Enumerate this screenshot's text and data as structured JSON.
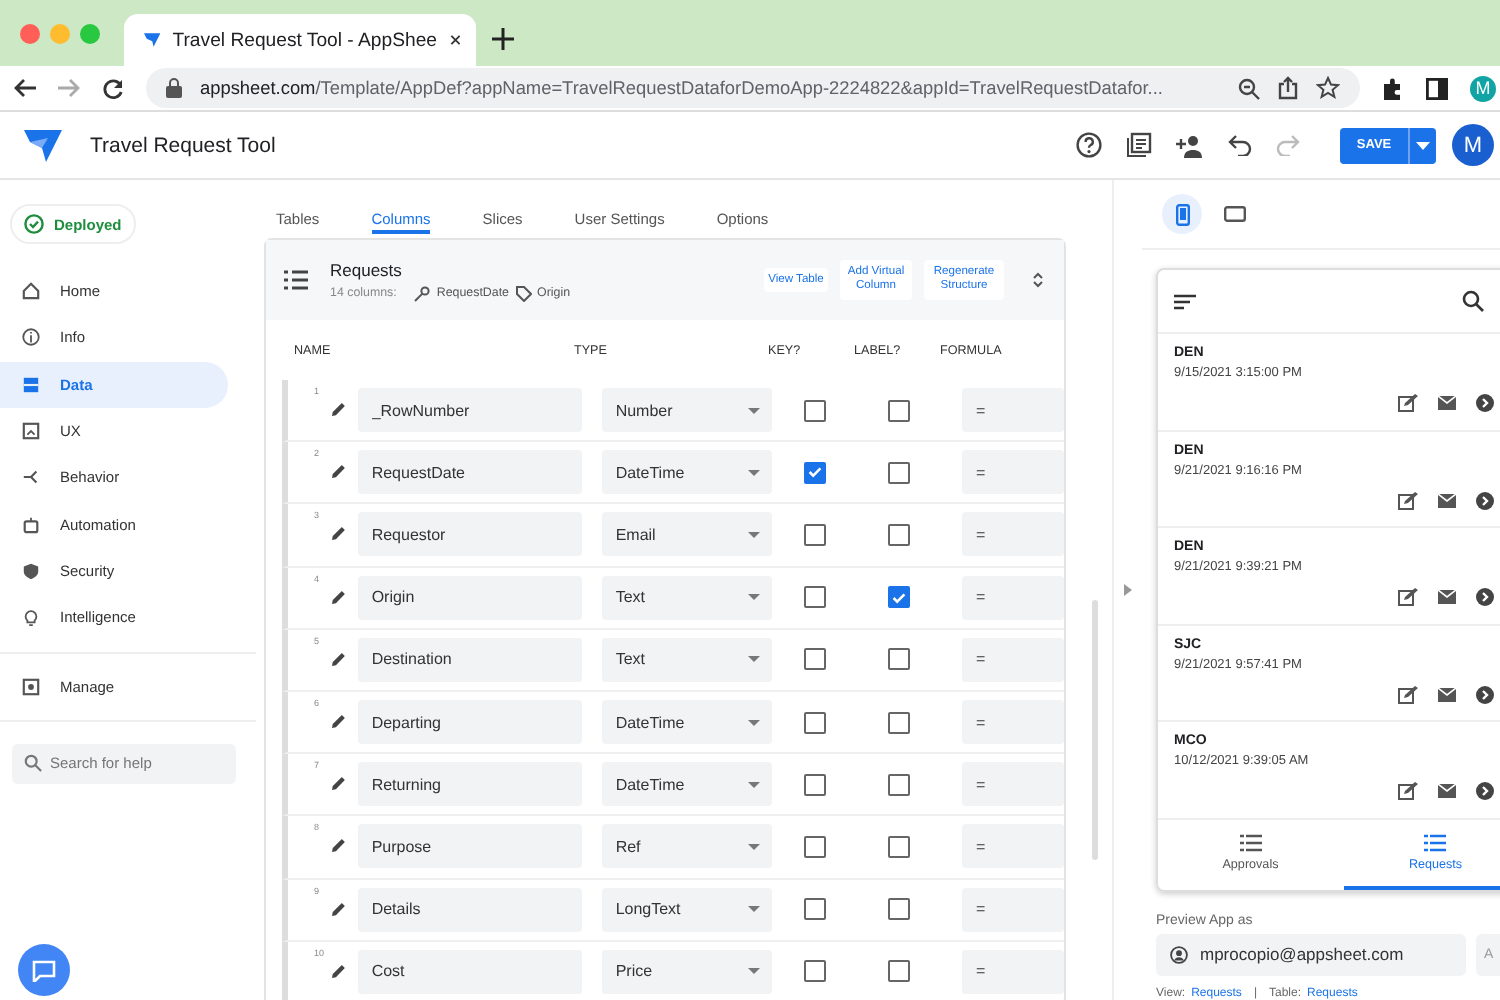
{
  "browser": {
    "tab_title": "Travel Request Tool - AppShee",
    "url_host": "appsheet.com",
    "url_path": "/Template/AppDef?appName=TravelRequestDataforDemoApp-2224822&appId=TravelRequestDatafor...",
    "profile_initial": "M"
  },
  "app": {
    "title": "Travel Request Tool",
    "save": "SAVE",
    "avatar_initial": "M"
  },
  "sidebar": {
    "status": "Deployed",
    "items": [
      {
        "label": "Home",
        "selected": false
      },
      {
        "label": "Info",
        "selected": false
      },
      {
        "label": "Data",
        "selected": true
      },
      {
        "label": "UX",
        "selected": false
      },
      {
        "label": "Behavior",
        "selected": false
      },
      {
        "label": "Automation",
        "selected": false
      },
      {
        "label": "Security",
        "selected": false
      },
      {
        "label": "Intelligence",
        "selected": false
      }
    ],
    "manage": "Manage",
    "search": {
      "placeholder": "Search for help"
    }
  },
  "tabs": [
    {
      "label": "Tables",
      "selected": false
    },
    {
      "label": "Columns",
      "selected": true
    },
    {
      "label": "Slices",
      "selected": false
    },
    {
      "label": "User Settings",
      "selected": false
    },
    {
      "label": "Options",
      "selected": false
    }
  ],
  "table": {
    "name": "Requests",
    "column_count": "14 columns:",
    "key_column": "RequestDate",
    "label_column": "Origin",
    "buttons": [
      "View Table",
      "Add Virtual Column",
      "Regenerate Structure"
    ],
    "headers": [
      "NAME",
      "TYPE",
      "KEY?",
      "LABEL?",
      "FORMULA"
    ],
    "rows": [
      {
        "number": "1",
        "name": "_RowNumber",
        "type": "Number",
        "key": false,
        "label": false,
        "formula": "="
      },
      {
        "number": "2",
        "name": "RequestDate",
        "type": "DateTime",
        "key": true,
        "label": false,
        "formula": "="
      },
      {
        "number": "3",
        "name": "Requestor",
        "type": "Email",
        "key": false,
        "label": false,
        "formula": "="
      },
      {
        "number": "4",
        "name": "Origin",
        "type": "Text",
        "key": false,
        "label": true,
        "formula": "="
      },
      {
        "number": "5",
        "name": "Destination",
        "type": "Text",
        "key": false,
        "label": false,
        "formula": "="
      },
      {
        "number": "6",
        "name": "Departing",
        "type": "DateTime",
        "key": false,
        "label": false,
        "formula": "="
      },
      {
        "number": "7",
        "name": "Returning",
        "type": "DateTime",
        "key": false,
        "label": false,
        "formula": "="
      },
      {
        "number": "8",
        "name": "Purpose",
        "type": "Ref",
        "key": false,
        "label": false,
        "formula": "="
      },
      {
        "number": "9",
        "name": "Details",
        "type": "LongText",
        "key": false,
        "label": false,
        "formula": "="
      },
      {
        "number": "10",
        "name": "Cost",
        "type": "Price",
        "key": false,
        "label": false,
        "formula": "="
      }
    ]
  },
  "preview": {
    "devices": [
      {
        "kind": "phone",
        "selected": true
      },
      {
        "kind": "tablet",
        "selected": false
      }
    ],
    "records": [
      {
        "title": "DEN",
        "date": "9/15/2021 3:15:00 PM"
      },
      {
        "title": "DEN",
        "date": "9/21/2021 9:16:16 PM"
      },
      {
        "title": "DEN",
        "date": "9/21/2021 9:39:21 PM"
      },
      {
        "title": "SJC",
        "date": "9/21/2021 9:57:41 PM"
      },
      {
        "title": "MCO",
        "date": "10/12/2021 9:39:05 AM"
      }
    ],
    "nav": [
      {
        "label": "Approvals",
        "selected": false
      },
      {
        "label": "Requests",
        "selected": true
      }
    ],
    "preview_as_label": "Preview App as",
    "user_email": "mprocopio@appsheet.com",
    "side_button": "A",
    "footer": {
      "view_label": "View:",
      "view": "Requests",
      "separator": "|",
      "table_label": "Table:",
      "table": "Requests"
    }
  }
}
